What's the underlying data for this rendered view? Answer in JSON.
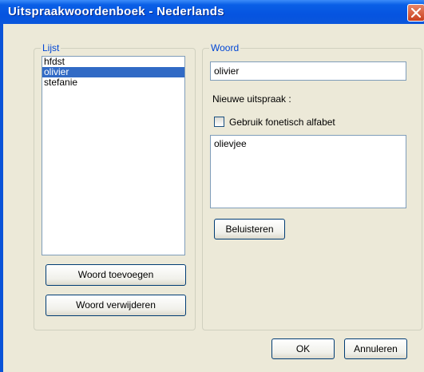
{
  "window": {
    "title": "Uitspraakwoordenboek - Nederlands"
  },
  "list_group": {
    "legend": "Lijst",
    "items": [
      "hfdst",
      "olivier",
      "stefanie"
    ],
    "selected_index": 1,
    "add_button": "Woord toevoegen",
    "remove_button": "Woord verwijderen"
  },
  "word_group": {
    "legend": "Woord",
    "word_value": "olivier",
    "new_pronunciation_label": "Nieuwe uitspraak :",
    "phonetic_checkbox_label": "Gebruik fonetisch alfabet",
    "phonetic_checked": false,
    "pronunciation_value": "olievjee",
    "listen_button": "Beluisteren"
  },
  "dialog_buttons": {
    "ok": "OK",
    "cancel": "Annuleren"
  },
  "colors": {
    "titlebar": "#0a5fe6",
    "selection": "#316ac5",
    "group_legend": "#0046d5",
    "dialog_face": "#ece9d8"
  }
}
